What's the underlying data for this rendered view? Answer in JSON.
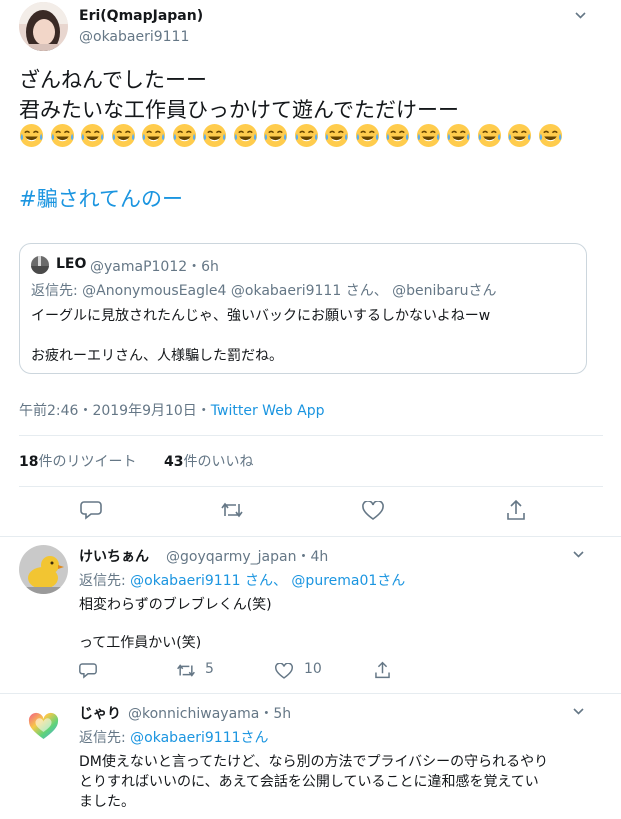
{
  "main_tweet": {
    "display_name": "Eri(QmapJapan)",
    "handle": "@okabaeri9111",
    "line1": "ざんねんでしたーー",
    "line2": "君みたいな工作員ひっかけて遊んでただけーー",
    "emoji_count": 18,
    "hashtag": "#騙されてんのー",
    "quoted": {
      "display_name": "LEO",
      "handle_time": "@yamaP1012・6h",
      "reply_to_prefix": "返信先: ",
      "reply_to_names": "@AnonymousEagle4 @okabaeri9111 さん、 @benibaruさん",
      "text1": "イーグルに見放されたんじゃ、強いバックにお願いするしかないよねーw",
      "text2": "お疲れーエリさん、人様騙した罰だね。"
    },
    "timestamp": "午前2:46・2019年9月10日・",
    "source": "Twitter Web App",
    "retweet_count": "18",
    "retweet_label": "件のリツイート",
    "like_count": "43",
    "like_label": "件のいいね"
  },
  "replies": [
    {
      "display_name": "けいちぁん",
      "handle_time": "@goyqarmy_japan・4h",
      "reply_to_prefix": "返信先: ",
      "reply_to_names": "@okabaeri9111 さん、 @purema01さん",
      "text1": "相変わらずのブレブレくん(笑)",
      "text2": "って工作員かい(笑)",
      "retweets": "5",
      "likes": "10"
    },
    {
      "display_name": "じゃり",
      "handle_time": "@konnichiwayama・5h",
      "reply_to_prefix": "返信先: ",
      "reply_to_names": "@okabaeri9111さん",
      "text1": "DM使えないと言ってたけど、なら別の方法でプライバシーの守られるやり",
      "text2": "とりすればいいのに、あえて会話を公開していることに違和感を覚えてい",
      "text3": "ました。"
    }
  ],
  "colors": {
    "link": "#1b95e0",
    "secondary": "#657786",
    "border": "#e6ecf0"
  }
}
